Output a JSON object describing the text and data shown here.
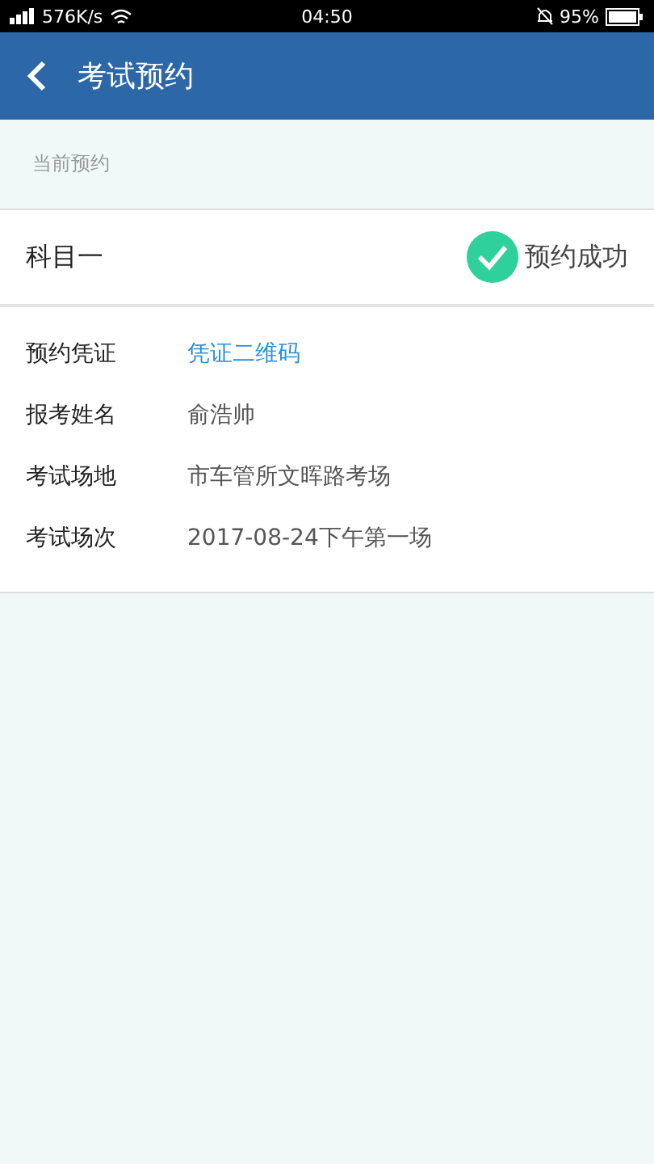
{
  "status_bar": {
    "network": "576K/s",
    "time": "04:50",
    "battery": "95%"
  },
  "header": {
    "title": "考试预约"
  },
  "section_label": "当前预约",
  "subject": {
    "name": "科目一",
    "status": "预约成功"
  },
  "details": [
    {
      "label": "预约凭证",
      "value": "凭证二维码",
      "kind": "link"
    },
    {
      "label": "报考姓名",
      "value": "俞浩帅",
      "kind": "text"
    },
    {
      "label": "考试场地",
      "value": "市车管所文晖路考场",
      "kind": "text"
    },
    {
      "label": "考试场次",
      "value": "2017-08-24下午第一场",
      "kind": "text"
    }
  ]
}
